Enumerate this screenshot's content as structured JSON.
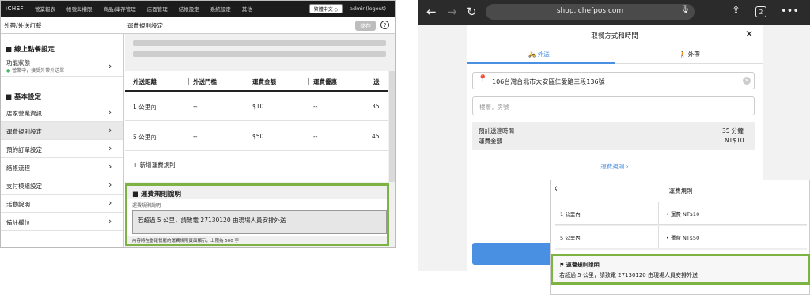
{
  "admin": {
    "logo": "iCHEF",
    "nav": [
      "營業報表",
      "帳號與權限",
      "商品/庫存管理",
      "店面管理",
      "結帳設定",
      "系統設定",
      "其他"
    ],
    "language": "繁體中文 ◇",
    "user": "admin(logout)",
    "breadcrumb": "外帶/外送訂餐",
    "page_title": "運費規則設定",
    "save_label": "儲存",
    "help_label": "?",
    "sidebar": {
      "online_title": "■ 線上點餐設定",
      "status_label": "功能狀態",
      "status_dot": "●",
      "status_sub": "營業中，接受外帶外送單",
      "basic_title": "■ 基本設定",
      "items": [
        {
          "label": "店家營業資訊"
        },
        {
          "label": "運費規則設定"
        },
        {
          "label": "預約訂單設定"
        },
        {
          "label": "結帳流程"
        },
        {
          "label": "支付模組設定"
        },
        {
          "label": "活動說明"
        },
        {
          "label": "備註欄位"
        }
      ]
    },
    "table": {
      "headers": [
        "外送距離",
        "外送門檻",
        "運費金額",
        "運費優惠",
        "送"
      ],
      "rows": [
        [
          "1 公里內",
          "--",
          "$10",
          "--",
          "35"
        ],
        [
          "5 公里內",
          "--",
          "$50",
          "--",
          "45"
        ]
      ],
      "add_label": "+   新增運費規則"
    },
    "note": {
      "title": "■ 運費規則說明",
      "label": "運費規則說明",
      "text": "若超過 5 公里，請致電 27130120 由現場人員安排外送",
      "hint": "內容將在當確餐廳的運費規則頁面顯示，上限為 500 字"
    }
  },
  "phone": {
    "url": "shop.ichefpos.com",
    "tab_count": "2",
    "dialog_title": "取餐方式和時間",
    "close": "✕",
    "tabs": [
      "外送",
      "外帶"
    ],
    "address": "106台灣台北市大安區仁愛路三段136號",
    "floor_placeholder": "樓層，房號",
    "est_time_label": "預計送達時間",
    "est_time_value": "35 分鐘",
    "fee_label": "運費金額",
    "fee_value": "NT$10",
    "fee_rules_link": "運費規則  ›"
  },
  "rules_panel": {
    "title": "運費規則",
    "rows": [
      {
        "distance": "1 公里內",
        "fee": "•  運費 NT$10"
      },
      {
        "distance": "5 公里內",
        "fee": "•  運費 NT$50"
      }
    ],
    "note_title": "運費規則說明",
    "note_text": "若超過 5 公里，請致電 27130120 由現場人員安排外送"
  },
  "colors": {
    "accent_green": "#7cb342",
    "accent_blue": "#4a90e2"
  }
}
